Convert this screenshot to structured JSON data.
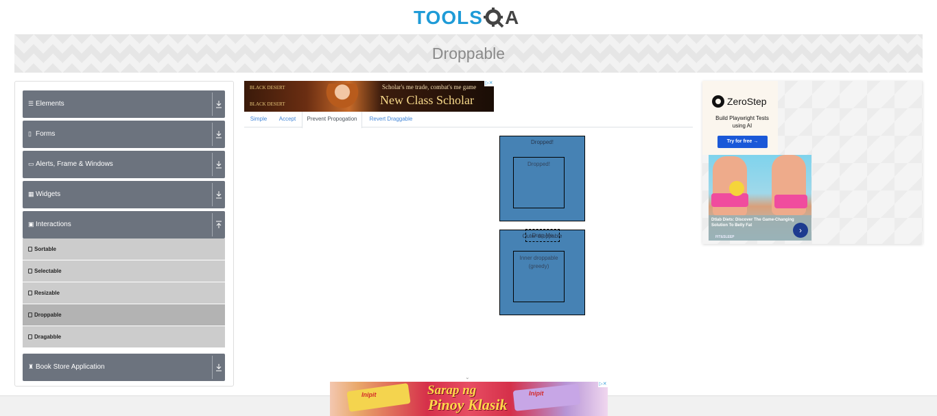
{
  "logo": {
    "part1": "TOOLS",
    "part2": "A"
  },
  "page_title": "Droppable",
  "sidebar": {
    "groups": [
      {
        "label": "Elements",
        "icon": "menu-icon",
        "expanded": false
      },
      {
        "label": "Forms",
        "icon": "form-icon",
        "expanded": false
      },
      {
        "label": "Alerts, Frame & Windows",
        "icon": "window-icon",
        "expanded": false
      },
      {
        "label": "Widgets",
        "icon": "grid-icon",
        "expanded": false
      },
      {
        "label": "Interactions",
        "icon": "interaction-icon",
        "expanded": true
      },
      {
        "label": "Book Store Application",
        "icon": "book-icon",
        "expanded": false
      }
    ],
    "items": [
      {
        "label": "Sortable",
        "active": false
      },
      {
        "label": "Selectable",
        "active": false
      },
      {
        "label": "Resizable",
        "active": false
      },
      {
        "label": "Droppable",
        "active": true
      },
      {
        "label": "Dragabble",
        "active": false
      }
    ]
  },
  "ad_top": {
    "brand_top": "BLACK DESERT",
    "brand_bottom": "BLACK DESERT",
    "line1": "Scholar's me trade, combat's me game",
    "line2": "New Class Scholar"
  },
  "tabs": [
    {
      "label": "Simple",
      "active": false
    },
    {
      "label": "Accept",
      "active": false
    },
    {
      "label": "Prevent Propogation",
      "active": true
    },
    {
      "label": "Revert Draggable",
      "active": false
    }
  ],
  "not_greedy": {
    "outer_text": "Dropped!",
    "inner_text": "Dropped!"
  },
  "greedy": {
    "outer_text": "Outer droppable",
    "inner_text": "Inner droppable (greedy)"
  },
  "drag_box": {
    "label": "Drag Me"
  },
  "ad_right": {
    "title": "ZeroStep",
    "subtitle": "Build Playwright Tests using AI",
    "button": "Try for free →",
    "diet_caption": "Dtlab Diets: Discover The Game-Changing Solution To Belly Fat",
    "diet_brand": "FIT&SLEEP"
  },
  "ad_bottom": {
    "brand": "Inipit",
    "slogan_line1": "Sarap ng",
    "slogan_line2": "Pinoy Klasik"
  },
  "colors": {
    "sidebar_group": "#6c737e",
    "sidebar_item": "#cccccc",
    "sidebar_item_active": "#b3b3b3",
    "droppable": "#4682b4",
    "link": "#3f84d8"
  }
}
